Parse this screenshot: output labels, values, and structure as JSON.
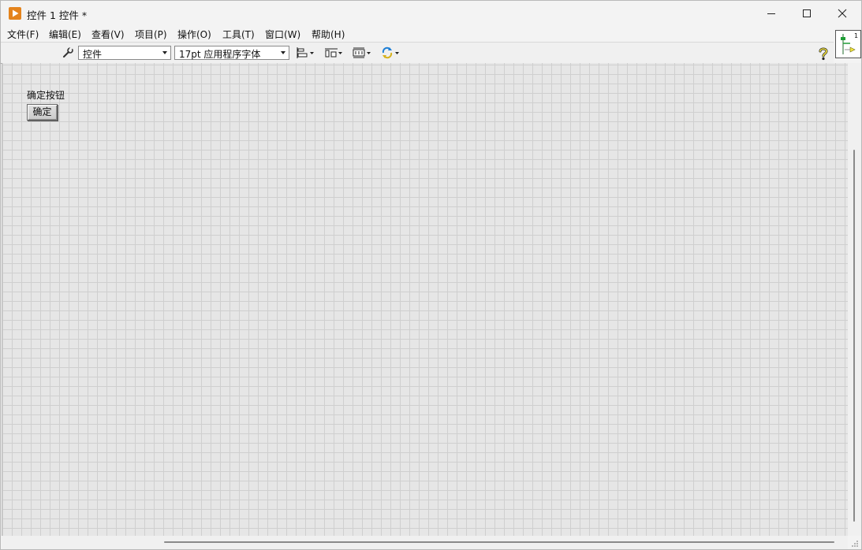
{
  "window": {
    "title": "控件 1 控件 *"
  },
  "menu": {
    "items": [
      {
        "label": "文件(F)"
      },
      {
        "label": "编辑(E)"
      },
      {
        "label": "查看(V)"
      },
      {
        "label": "项目(P)"
      },
      {
        "label": "操作(O)"
      },
      {
        "label": "工具(T)"
      },
      {
        "label": "窗口(W)"
      },
      {
        "label": "帮助(H)"
      }
    ]
  },
  "toolbar": {
    "control_type_value": "控件",
    "font_value": "17pt 应用程序字体",
    "icons": [
      "wrench-icon",
      "align-objects-icon",
      "distribute-objects-icon",
      "resize-objects-icon",
      "reorder-icon",
      "help-icon"
    ]
  },
  "connector_pane": {
    "number": "1"
  },
  "front_panel": {
    "control_label": "确定按钮",
    "button_text": "确定"
  },
  "colors": {
    "app_icon": "#e4831c",
    "canvas_bg": "#e6e6e6",
    "grid_line": "#cfcfcf"
  }
}
